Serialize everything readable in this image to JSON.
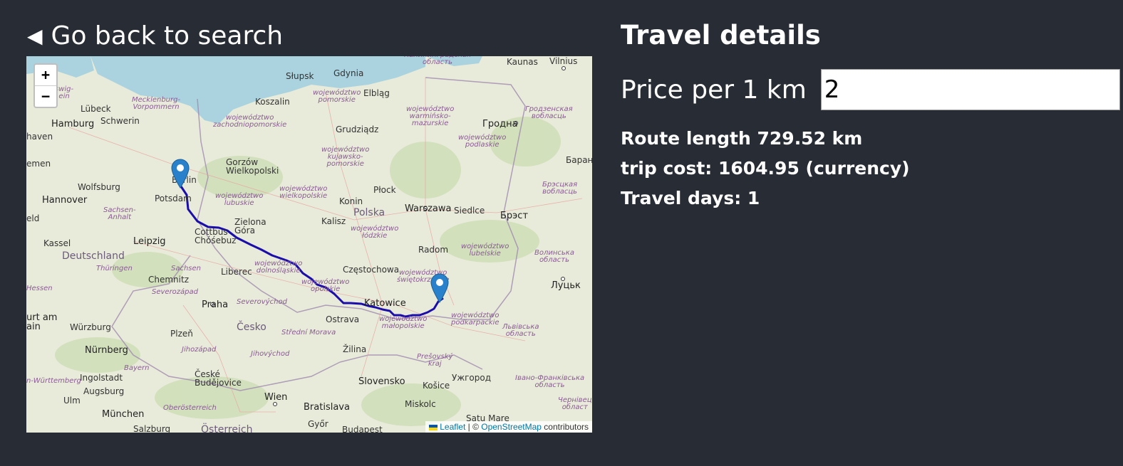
{
  "back": {
    "label": "Go back to search",
    "icon": "triangle-left-icon"
  },
  "map": {
    "zoom_in": "+",
    "zoom_out": "−",
    "attribution": {
      "leaflet": "Leaflet",
      "sep": " | © ",
      "osm": "OpenStreetMap",
      "suffix": " contributors"
    },
    "route_color": "#1a0dab",
    "water_color": "#aad3df",
    "cities": {
      "kaunas": "Kaunas",
      "vilnius": "Vilnius",
      "slupsk": "Słupsk",
      "gdynia": "Gdynia",
      "elblag": "Elbląg",
      "koszalin": "Koszalin",
      "lubeck": "Lübeck",
      "schwerin": "Schwerin",
      "hamburg": "Hamburg",
      "grudziadz": "Grudziądz",
      "grodno": "Гродна",
      "gorzow": "Gorzów\nWielkopolski",
      "berlin": "Berlin",
      "wolfsburg": "Wolfsburg",
      "hannover": "Hannover",
      "potsdam": "Potsdam",
      "plock": "Płock",
      "konin": "Konin",
      "polska": "Polska",
      "warszawa": "Warszawa",
      "siedlce": "Siedlce",
      "brest": "Брэст",
      "kalisz": "Kalisz",
      "zielona": "Zielona\nGóra",
      "cottbus": "Cottbus\nChóśebuz",
      "leipzig": "Leipzig",
      "kassel": "Kassel",
      "deutschland": "Deutschland",
      "radom": "Radom",
      "czestochowa": "Częstochowa",
      "liberec": "Liberec",
      "chemnitz": "Chemnitz",
      "katowice": "Katowice",
      "ostrava": "Ostrava",
      "praha": "Praha",
      "cesko": "Česko",
      "plzen": "Plzeň",
      "wurzburg": "Würzburg",
      "nurnberg": "Nürnberg",
      "zilina": "Žilina",
      "lutsk": "Луцьк",
      "ingolstadt": "Ingolstadt",
      "augsburg": "Augsburg",
      "ceske": "České\nBudějovice",
      "slovensko": "Slovensko",
      "kosice": "Košice",
      "uzhgorod": "Ужгород",
      "wien": "Wien",
      "bratislava": "Bratislava",
      "munchen": "München",
      "miskolc": "Miskolc",
      "ulm": "Ulm",
      "salzburg": "Salzburg",
      "osterreich": "Österreich",
      "gyor": "Győr",
      "budapest": "Budapest",
      "satu": "Satu Mare",
      "baranovichi": "Баранав",
      "haven": "haven",
      "emen": "emen",
      "eld": "eld",
      "urt": "urt am\nain"
    },
    "regions": {
      "mecklenburg": "Mecklenburg-\nVorpommern",
      "pomorskie": "województwo\npomorskie",
      "warminsko": "województwo\nwarmińsko-\nmazurskie",
      "zachodnio": "województwo\nzachodniopomorskie",
      "kujawsko": "województwo\nkujawsko-\npomorskie",
      "podlaskie": "województwo\npodlaskie",
      "grodzen": "Гродзенская\nвобласць",
      "lubuskie": "województwo\nlubuskie",
      "wielkopolskie": "województwo\nwielkopolskie",
      "brest_obl": "Брэсцкая\nвобласць",
      "sachsen_anhalt": "Sachsen-\nAnhalt",
      "lodzkie": "województwo\nłódzkie",
      "lubelskie": "województwo\nlubelskie",
      "wolyn": "Волинська\nобласть",
      "thuringen": "Thüringen",
      "sachsen": "Sachsen",
      "dolnoslaskie": "województwo\ndolnośląskie",
      "swietokrzyskie": "województwo\nświętokrzyskie",
      "opolskie": "województwo\nopolskie",
      "hessen": "Hessen",
      "severozapad": "Severozápad",
      "severovychod": "Severovýchod",
      "malopolskie": "województwo\nmałopolskie",
      "podkarpackie": "województwo\npodkarpackie",
      "lviv": "Львівська\nобласть",
      "strednimorava": "Střední Morava",
      "jihozapad": "Jihozápad",
      "jihovychod": "Jihovýchod",
      "presov": "Prešovský\nkraj",
      "bayern": "Bayern",
      "wurttemberg": "n-Württemberg",
      "oberosterreich": "Oberösterreich",
      "ivano": "Івано-Франківська\nобласть",
      "chernivtsi": "Чернівец\nобласт",
      "kaliningrad": "Калининградская\nобласть",
      "swig": "swig-\nein"
    }
  },
  "details": {
    "title": "Travel details",
    "price_label": "Price per 1 km",
    "price_value": "2",
    "route_length": "Route length 729.52 km",
    "trip_cost": "trip cost: 1604.95 (currency)",
    "travel_days": "Travel days: 1"
  }
}
